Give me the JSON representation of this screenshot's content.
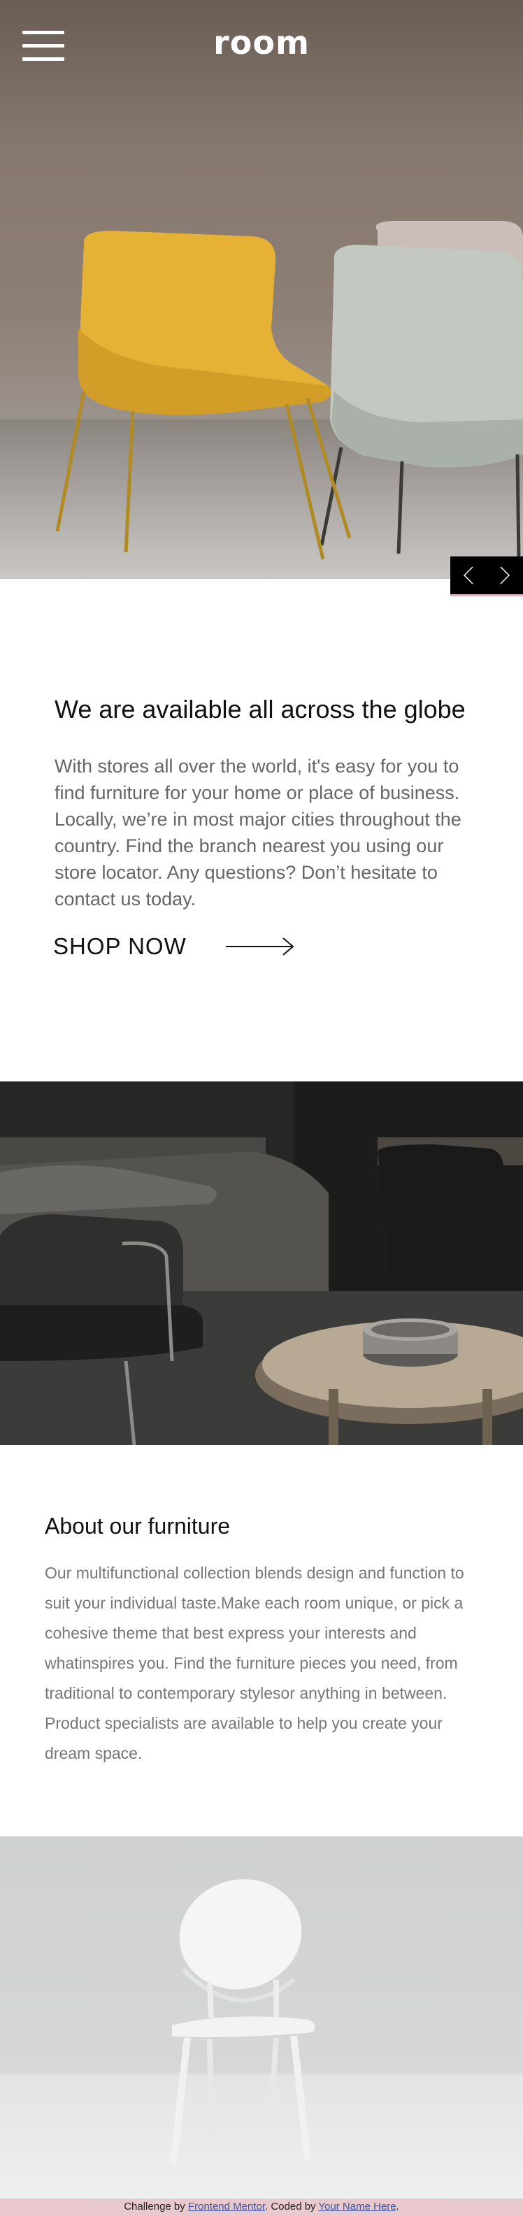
{
  "header": {
    "logo": "room",
    "menu_icon": "hamburger-menu-icon"
  },
  "slider": {
    "prev_icon": "chevron-left-icon",
    "next_icon": "chevron-right-icon"
  },
  "globe_section": {
    "title": "We are available all across the globe",
    "body": "With stores all over the world, it's easy for you to find furniture for your home or place of business. Locally, we’re in most major cities throughout the country. Find the branch nearest you using our store locator. Any questions? Don’t hesitate to contact us today.",
    "cta_label": "SHOP NOW",
    "cta_icon": "long-arrow-right-icon"
  },
  "about_section": {
    "title": "About our furniture",
    "body": "Our multifunctional collection blends design and function to suit your individual taste.Make each room unique, or pick a cohesive theme that best express your interests and whatinspires you. Find the furniture pieces you need, from traditional to contemporary stylesor anything in between. Product specialists are available to help you create your dream space."
  },
  "footer": {
    "prefix": "Challenge by ",
    "challenge_link": "Frontend Mentor",
    "middle": ". Coded by ",
    "author_link": "Your Name Here",
    "suffix": "."
  },
  "colors": {
    "accent_bar": "#e9c9cd",
    "link": "#3e52a3",
    "heading": "#111111",
    "body_text": "#666666"
  }
}
